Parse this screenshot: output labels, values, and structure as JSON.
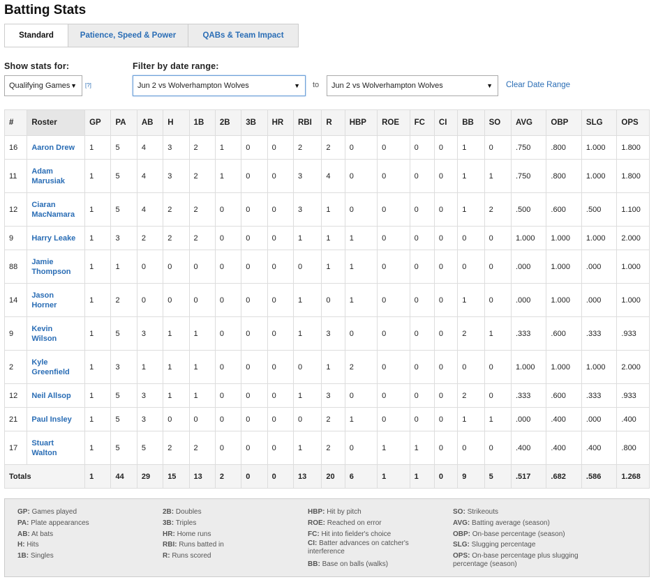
{
  "page_title": "Batting Stats",
  "tabs": [
    {
      "label": "Standard",
      "active": true
    },
    {
      "label": "Patience, Speed & Power",
      "active": false
    },
    {
      "label": "QABs & Team Impact",
      "active": false
    }
  ],
  "filters": {
    "show_label": "Show stats for:",
    "show_value": "Qualifying Games",
    "help_text": "[?]",
    "date_label": "Filter by date range:",
    "from_value": "Jun 2 vs Wolverhampton Wolves",
    "to_text": "to",
    "to_value": "Jun 2 vs Wolverhampton Wolves",
    "clear_label": "Clear Date Range"
  },
  "table": {
    "columns": [
      "#",
      "Roster",
      "GP",
      "PA",
      "AB",
      "H",
      "1B",
      "2B",
      "3B",
      "HR",
      "RBI",
      "R",
      "HBP",
      "ROE",
      "FC",
      "CI",
      "BB",
      "SO",
      "AVG",
      "OBP",
      "SLG",
      "OPS"
    ],
    "rows": [
      {
        "num": "16",
        "name": [
          "Aaron Drew"
        ],
        "stats": [
          "1",
          "5",
          "4",
          "3",
          "2",
          "1",
          "0",
          "0",
          "2",
          "2",
          "0",
          "0",
          "0",
          "0",
          "1",
          "0",
          ".750",
          ".800",
          "1.000",
          "1.800"
        ]
      },
      {
        "num": "11",
        "name": [
          "Adam",
          "Marusiak"
        ],
        "stats": [
          "1",
          "5",
          "4",
          "3",
          "2",
          "1",
          "0",
          "0",
          "3",
          "4",
          "0",
          "0",
          "0",
          "0",
          "1",
          "1",
          ".750",
          ".800",
          "1.000",
          "1.800"
        ]
      },
      {
        "num": "12",
        "name": [
          "Ciaran",
          "MacNamara"
        ],
        "stats": [
          "1",
          "5",
          "4",
          "2",
          "2",
          "0",
          "0",
          "0",
          "3",
          "1",
          "0",
          "0",
          "0",
          "0",
          "1",
          "2",
          ".500",
          ".600",
          ".500",
          "1.100"
        ]
      },
      {
        "num": "9",
        "name": [
          "Harry Leake"
        ],
        "stats": [
          "1",
          "3",
          "2",
          "2",
          "2",
          "0",
          "0",
          "0",
          "1",
          "1",
          "1",
          "0",
          "0",
          "0",
          "0",
          "0",
          "1.000",
          "1.000",
          "1.000",
          "2.000"
        ]
      },
      {
        "num": "88",
        "name": [
          "Jamie",
          "Thompson"
        ],
        "stats": [
          "1",
          "1",
          "0",
          "0",
          "0",
          "0",
          "0",
          "0",
          "0",
          "1",
          "1",
          "0",
          "0",
          "0",
          "0",
          "0",
          ".000",
          "1.000",
          ".000",
          "1.000"
        ]
      },
      {
        "num": "14",
        "name": [
          "Jason",
          "Horner"
        ],
        "stats": [
          "1",
          "2",
          "0",
          "0",
          "0",
          "0",
          "0",
          "0",
          "1",
          "0",
          "1",
          "0",
          "0",
          "0",
          "1",
          "0",
          ".000",
          "1.000",
          ".000",
          "1.000"
        ]
      },
      {
        "num": "9",
        "name": [
          "Kevin",
          "Wilson"
        ],
        "stats": [
          "1",
          "5",
          "3",
          "1",
          "1",
          "0",
          "0",
          "0",
          "1",
          "3",
          "0",
          "0",
          "0",
          "0",
          "2",
          "1",
          ".333",
          ".600",
          ".333",
          ".933"
        ]
      },
      {
        "num": "2",
        "name": [
          "Kyle",
          "Greenfield"
        ],
        "stats": [
          "1",
          "3",
          "1",
          "1",
          "1",
          "0",
          "0",
          "0",
          "0",
          "1",
          "2",
          "0",
          "0",
          "0",
          "0",
          "0",
          "1.000",
          "1.000",
          "1.000",
          "2.000"
        ]
      },
      {
        "num": "12",
        "name": [
          "Neil Allsop"
        ],
        "stats": [
          "1",
          "5",
          "3",
          "1",
          "1",
          "0",
          "0",
          "0",
          "1",
          "3",
          "0",
          "0",
          "0",
          "0",
          "2",
          "0",
          ".333",
          ".600",
          ".333",
          ".933"
        ]
      },
      {
        "num": "21",
        "name": [
          "Paul Insley"
        ],
        "stats": [
          "1",
          "5",
          "3",
          "0",
          "0",
          "0",
          "0",
          "0",
          "0",
          "2",
          "1",
          "0",
          "0",
          "0",
          "1",
          "1",
          ".000",
          ".400",
          ".000",
          ".400"
        ]
      },
      {
        "num": "17",
        "name": [
          "Stuart",
          "Walton"
        ],
        "stats": [
          "1",
          "5",
          "5",
          "2",
          "2",
          "0",
          "0",
          "0",
          "1",
          "2",
          "0",
          "1",
          "1",
          "0",
          "0",
          "0",
          ".400",
          ".400",
          ".400",
          ".800"
        ]
      }
    ],
    "totals": {
      "label": "Totals",
      "stats": [
        "1",
        "44",
        "29",
        "15",
        "13",
        "2",
        "0",
        "0",
        "13",
        "20",
        "6",
        "1",
        "1",
        "0",
        "9",
        "5",
        ".517",
        ".682",
        ".586",
        "1.268"
      ]
    }
  },
  "legend": {
    "col1": [
      {
        "abbr": "GP:",
        "desc": "Games played"
      },
      {
        "abbr": "PA:",
        "desc": "Plate appearances"
      },
      {
        "abbr": "AB:",
        "desc": "At bats"
      },
      {
        "abbr": "H:",
        "desc": "Hits"
      },
      {
        "abbr": "1B:",
        "desc": "Singles"
      }
    ],
    "col2": [
      {
        "abbr": "2B:",
        "desc": "Doubles"
      },
      {
        "abbr": "3B:",
        "desc": "Triples"
      },
      {
        "abbr": "HR:",
        "desc": "Home runs"
      },
      {
        "abbr": "RBI:",
        "desc": "Runs batted in"
      },
      {
        "abbr": "R:",
        "desc": "Runs scored"
      }
    ],
    "col3": [
      {
        "abbr": "HBP:",
        "desc": "Hit by pitch"
      },
      {
        "abbr": "ROE:",
        "desc": "Reached on error"
      },
      {
        "abbr": "FC:",
        "desc": "Hit into fielder's choice"
      },
      {
        "abbr": "CI:",
        "desc": "Batter advances on catcher's interference"
      },
      {
        "abbr": "BB:",
        "desc": "Base on balls (walks)"
      }
    ],
    "col4": [
      {
        "abbr": "SO:",
        "desc": "Strikeouts"
      },
      {
        "abbr": "AVG:",
        "desc": "Batting average (season)"
      },
      {
        "abbr": "OBP:",
        "desc": "On-base percentage (season)"
      },
      {
        "abbr": "SLG:",
        "desc": "Slugging percentage"
      },
      {
        "abbr": "OPS:",
        "desc": "On-base percentage plus slugging percentage (season)"
      }
    ]
  }
}
